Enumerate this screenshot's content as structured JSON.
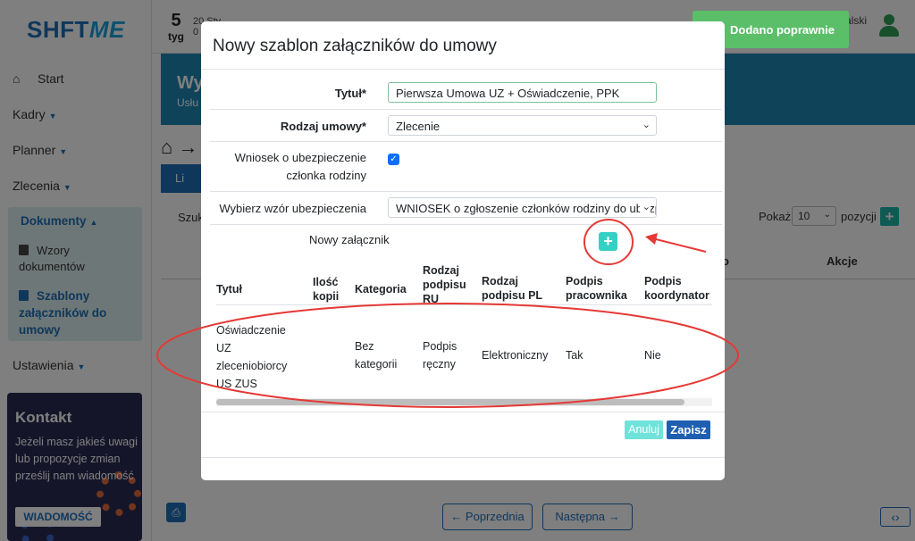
{
  "sidebar": {
    "logo_main": "SHFT",
    "logo_accent": "ME",
    "start_label": "Start",
    "items": [
      {
        "label": "Kadry"
      },
      {
        "label": "Planner"
      },
      {
        "label": "Zlecenia"
      }
    ],
    "documents": {
      "label": "Dokumenty",
      "sub_items": [
        {
          "label": "Wzory dokumentów"
        },
        {
          "label": "Szablony załączników do umowy"
        }
      ]
    },
    "settings_label": "Ustawienia",
    "contact": {
      "title": "Kontakt",
      "text": "Jeżeli masz jakieś uwagi lub propozycje zmian prześlij nam wiadomość",
      "button": "WIADOMOŚĆ"
    }
  },
  "topbar": {
    "week_number": "5",
    "week_label": "tyg",
    "date_fragment": "20 Sty",
    "date_fragment_2": "0",
    "user_name": "Witaj Jan Kowalski"
  },
  "background": {
    "banner_title": "Wy",
    "banner_subtitle": "Usłu",
    "tab_label": "Li",
    "search_label": "Szuk",
    "show_label": "Pokaż",
    "page_size": "10",
    "rows_label": "pozycji",
    "col_o": "o",
    "col_actions": "Akcje",
    "prev_label": "Poprzednia",
    "next_label": "Następna"
  },
  "toast": {
    "message": "Dodano poprawnie"
  },
  "modal": {
    "title": "Nowy szablon załączników do umowy",
    "fields": {
      "title_label": "Tytuł*",
      "title_value": "Pierwsza Umowa UZ + Oświadczenie, PPK",
      "contract_type_label": "Rodzaj umowy*",
      "contract_type_value": "Zlecenie",
      "family_insurance_label_1": "Wniosek o ubezpieczenie",
      "family_insurance_label_2": "członka rodziny",
      "family_insurance_checked": true,
      "insurance_template_label": "Wybierz wzór ubezpieczenia",
      "insurance_template_value": "WNIOSEK o zgłoszenie członków rodziny do ubezpieczenia"
    },
    "new_attachment_label": "Nowy załącznik",
    "table": {
      "headers": [
        {
          "lines": [
            "Tytuł"
          ]
        },
        {
          "lines": [
            "Ilość",
            "kopii"
          ]
        },
        {
          "lines": [
            "Kategoria"
          ]
        },
        {
          "lines": [
            "Rodzaj",
            "podpisu",
            "RU"
          ]
        },
        {
          "lines": [
            "Rodzaj",
            "podpisu PL"
          ]
        },
        {
          "lines": [
            "Podpis",
            "pracownika"
          ]
        },
        {
          "lines": [
            "Podpis",
            "koordynator"
          ]
        }
      ],
      "rows": [
        {
          "title": [
            "Oświadczenie",
            "UZ",
            "zleceniobiorcy",
            "US ZUS"
          ],
          "copies": "",
          "category": [
            "Bez",
            "kategorii"
          ],
          "signature_ru": [
            "Podpis",
            "ręczny"
          ],
          "signature_pl": "Elektroniczny",
          "employee_signature": "Tak",
          "coordinator_signature": "Nie"
        }
      ]
    },
    "cancel_label": "Anuluj",
    "save_label": "Zapisz"
  },
  "colors": {
    "accent": "#1e6fb8",
    "teal": "#35d0c4",
    "toast": "#5bbf69",
    "annotation": "#e53935"
  }
}
